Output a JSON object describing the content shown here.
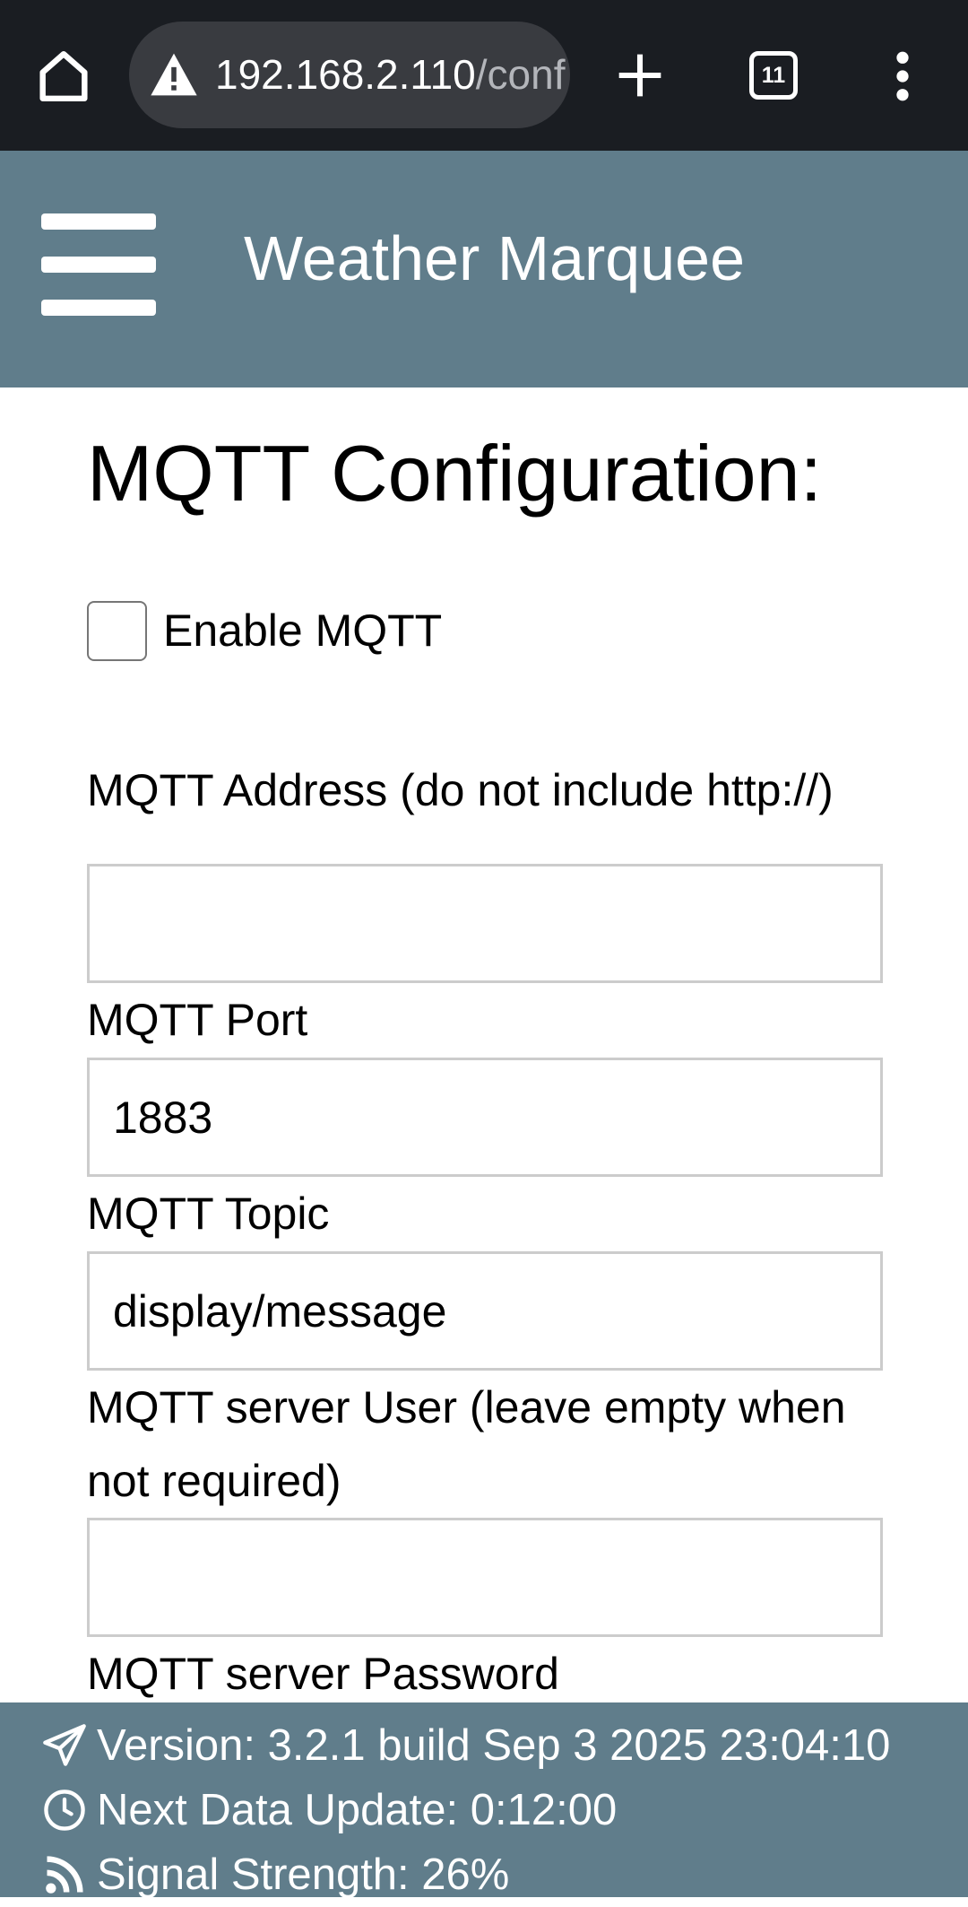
{
  "browser": {
    "url_host": "192.168.2.110",
    "url_path": "/conf",
    "tab_count": "11"
  },
  "header": {
    "title": "Weather Marquee"
  },
  "form": {
    "title": "MQTT Configuration:",
    "enable_label": "Enable MQTT",
    "enable_checked": false,
    "address_label": "MQTT Address (do not include http://)",
    "address_value": "",
    "port_label": "MQTT Port",
    "port_value": "1883",
    "topic_label": "MQTT Topic",
    "topic_value": "display/message",
    "user_label": "MQTT server User (leave empty when not required)",
    "user_value": "",
    "password_label": "MQTT server Password"
  },
  "footer": {
    "version": "Version: 3.2.1 build Sep 3 2025 23:04:10",
    "next_update": "Next Data Update: 0:12:00",
    "signal": "Signal Strength: 26%"
  },
  "colors": {
    "header_bg": "#607d8b",
    "chrome_bg": "#1a1d22"
  },
  "icons": [
    "home-icon",
    "warning-icon",
    "plus-icon",
    "tabs-icon",
    "more-vert-icon",
    "hamburger-icon",
    "paper-plane-icon",
    "clock-icon",
    "rss-icon"
  ]
}
